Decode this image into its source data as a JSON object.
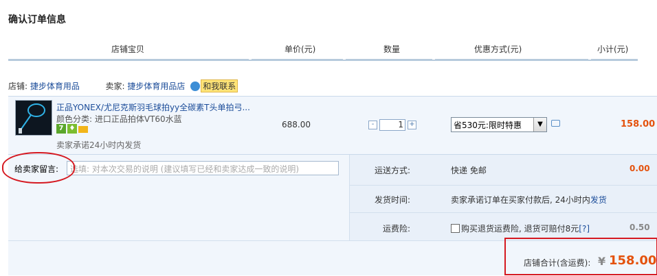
{
  "page_title": "确认订单信息",
  "columns": [
    "店铺宝贝",
    "单价(元)",
    "数量",
    "优惠方式(元)",
    "小计(元)"
  ],
  "shop": {
    "shop_label": "店铺:",
    "shop_name": "捷步体育用品",
    "seller_label": "卖家:",
    "seller_name": "捷步体育用品店",
    "contact_label": "和我联系"
  },
  "item": {
    "name": "正品YONEX/尤尼克斯羽毛球拍yy全碳素T头单拍弓...",
    "spec": "颜色分类: 进口正品拍体VT60水蓝",
    "promise": "卖家承诺24小时内发货",
    "price": "688.00",
    "quantity": "1",
    "qty_minus": "-",
    "qty_plus": "+",
    "discount": "省530元:限时特惠",
    "subtotal": "158.00",
    "badge_seven": "7"
  },
  "message": {
    "label": "给卖家留言:",
    "placeholder": "选填: 对本次交易的说明 (建议填写已经和卖家达成一致的说明)"
  },
  "shipping": {
    "method_label": "运送方式:",
    "method_value": "快递 免邮",
    "method_fee": "0.00",
    "time_label": "发货时间:",
    "time_value_prefix": "卖家承诺订单在买家付款后, 24小时内",
    "time_link": "发货",
    "insurance_label": "运费险:",
    "insurance_text": "购买退货运费险, 退货可赔付8元",
    "insurance_help": "[?]",
    "insurance_fee": "0.50"
  },
  "total": {
    "label": "店铺合计(含运费):",
    "currency": "¥",
    "value": "158.00"
  },
  "colors": {
    "link": "#1b4c99",
    "price_orange": "#e4520d",
    "annotation_red": "#d51820",
    "row_bg": "#f1f6fc"
  }
}
